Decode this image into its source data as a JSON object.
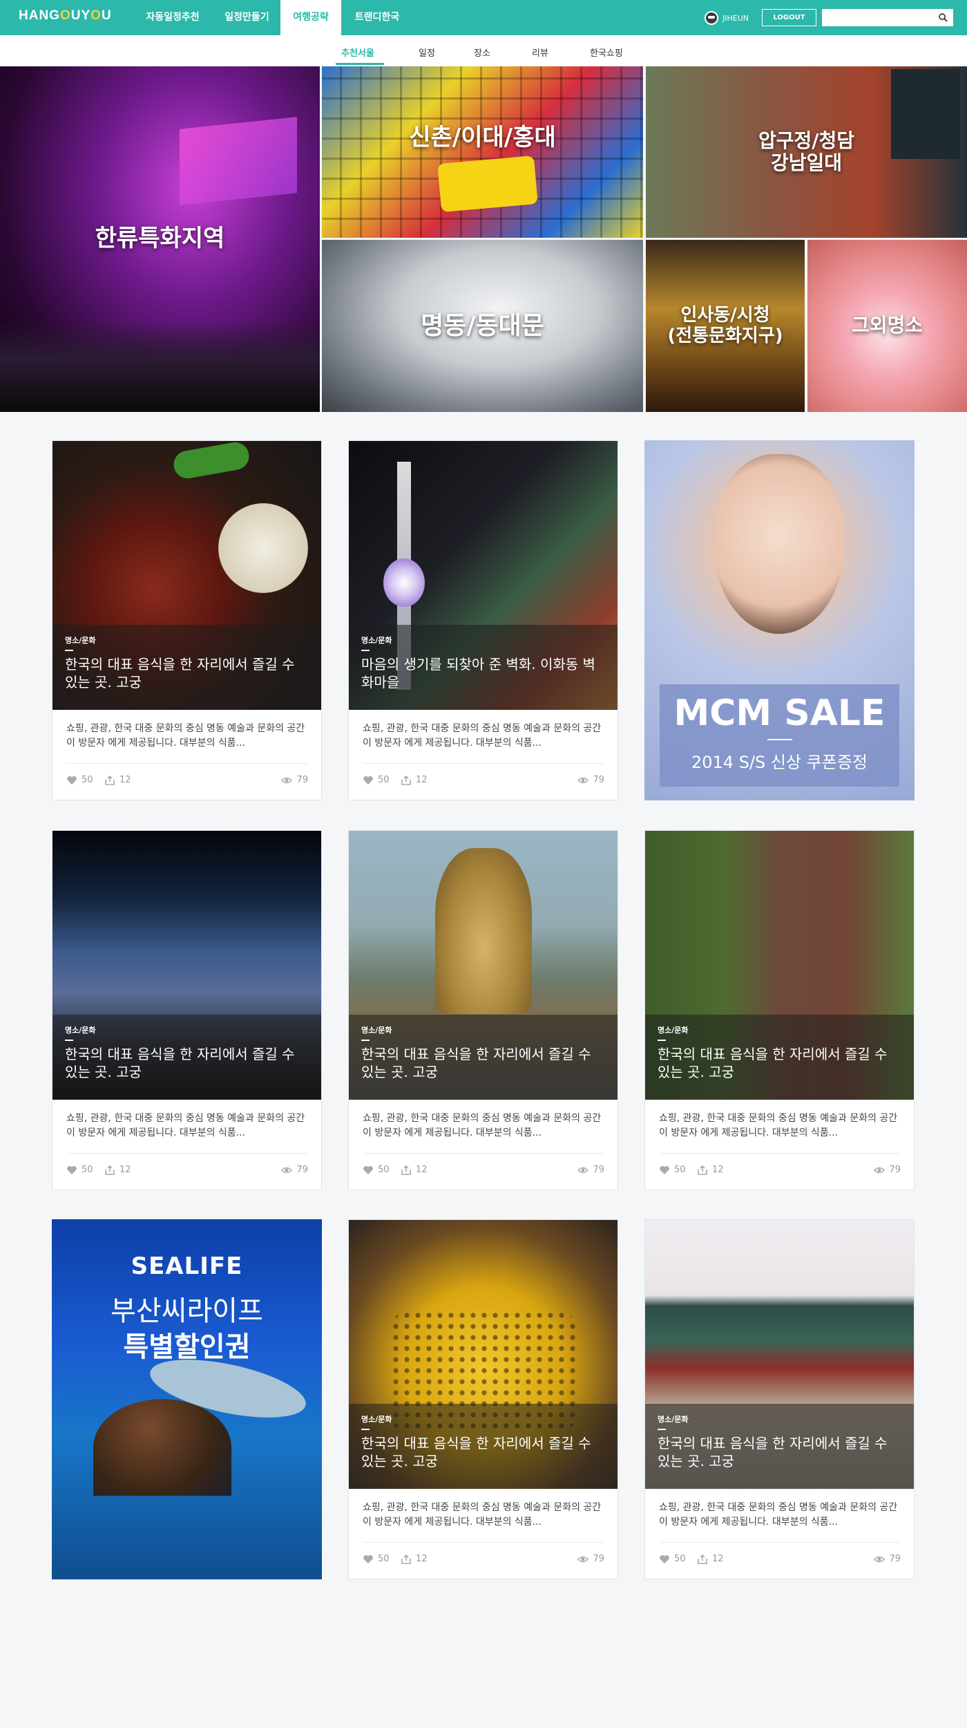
{
  "header": {
    "logo_parts": [
      "HANG",
      "O",
      "U",
      "Y",
      "O",
      "U"
    ],
    "nav": [
      "자동일정추천",
      "일정만들기",
      "여행공략",
      "트랜디한국"
    ],
    "active_nav": 2,
    "user_name": "JIHEUN",
    "logout_label": "LOGOUT",
    "search_placeholder": ""
  },
  "subnav": {
    "items": [
      "추천서울",
      "일정",
      "장소",
      "리뷰",
      "한국쇼핑"
    ],
    "active": 0
  },
  "hero": {
    "tiles": [
      {
        "label": "한류특화지역"
      },
      {
        "label": "신촌/이대/홍대"
      },
      {
        "label": "압구정/청담\n강남일대"
      },
      {
        "label": "명동/동대문"
      },
      {
        "label": "인사동/시청\n(전통문화지구)"
      },
      {
        "label": "그외명소"
      }
    ]
  },
  "cards": [
    {
      "type": "post",
      "category": "명소/문화",
      "title": "한국의 대표 음식을 한 자리에서 즐길 수 있는 곳. 고궁",
      "desc": "쇼핑, 관광, 한국 대중 문화의 중심 명동 예술과 문화의 공간이 방문자 에게 제공됩니다. 대부분의 식품...",
      "likes": "50",
      "shares": "12",
      "views": "79"
    },
    {
      "type": "post",
      "category": "명소/문화",
      "title": "마음의 생기를 되찾아 준 벽화. 이화동 벽화마을",
      "desc": "쇼핑, 관광, 한국 대중 문화의 중심 명동 예술과 문화의 공간이 방문자 에게 제공됩니다. 대부분의 식품...",
      "likes": "50",
      "shares": "12",
      "views": "79"
    },
    {
      "type": "ad",
      "ad_title": "MCM SALE",
      "ad_sub": "2014 S/S 신상 쿠폰증정"
    },
    {
      "type": "post",
      "category": "명소/문화",
      "title": "한국의 대표 음식을 한 자리에서 즐길 수 있는 곳. 고궁",
      "desc": "쇼핑, 관광, 한국 대중 문화의 중심 명동 예술과 문화의 공간이 방문자 에게 제공됩니다. 대부분의 식품...",
      "likes": "50",
      "shares": "12",
      "views": "79"
    },
    {
      "type": "post",
      "category": "명소/문화",
      "title": "한국의 대표 음식을 한 자리에서 즐길 수 있는 곳. 고궁",
      "desc": "쇼핑, 관광, 한국 대중 문화의 중심 명동 예술과 문화의 공간이 방문자 에게 제공됩니다. 대부분의 식품...",
      "likes": "50",
      "shares": "12",
      "views": "79"
    },
    {
      "type": "post",
      "category": "명소/문화",
      "title": "한국의 대표 음식을 한 자리에서 즐길 수 있는 곳. 고궁",
      "desc": "쇼핑, 관광, 한국 대중 문화의 중심 명동 예술과 문화의 공간이 방문자 에게 제공됩니다. 대부분의 식품...",
      "likes": "50",
      "shares": "12",
      "views": "79"
    },
    {
      "type": "ad",
      "ad_logo": "SEALIFE",
      "ad_title": "부산씨라이프",
      "ad_sub": "특별할인권"
    },
    {
      "type": "post",
      "category": "명소/문화",
      "title": "한국의 대표 음식을 한 자리에서 즐길 수 있는 곳. 고궁",
      "desc": "쇼핑, 관광, 한국 대중 문화의 중심 명동 예술과 문화의 공간이 방문자 에게 제공됩니다. 대부분의 식품...",
      "likes": "50",
      "shares": "12",
      "views": "79"
    },
    {
      "type": "post",
      "category": "명소/문화",
      "title": "한국의 대표 음식을 한 자리에서 즐길 수 있는 곳. 고궁",
      "desc": "쇼핑, 관광, 한국 대중 문화의 중심 명동 예술과 문화의 공간이 방문자 에게 제공됩니다. 대부분의 식품...",
      "likes": "50",
      "shares": "12",
      "views": "79"
    }
  ],
  "colors": {
    "accent": "#2cb8aa",
    "logo_highlight": "#f4d23b",
    "background": "#f4f6f8"
  },
  "icons": {
    "like": "heart-icon",
    "share": "share-icon",
    "views": "eye-icon",
    "search": "search-icon"
  }
}
